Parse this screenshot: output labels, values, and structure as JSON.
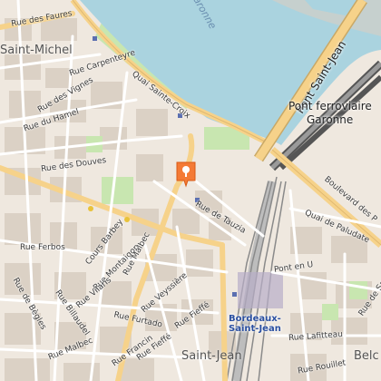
{
  "map": {
    "colors": {
      "water": "#aad3df",
      "land": "#efe8df",
      "park": "#c8e6b0",
      "road_major": "#f6d28a",
      "road_minor": "#ffffff",
      "building": "#d9cfc3",
      "rail": "#8a8a8a",
      "marker": "#f47a35"
    },
    "marker": {
      "icon": "map-pin-icon"
    },
    "labels": {
      "garonne_top": "Garonne",
      "saint_michel": "Saint-Michel",
      "rue_des_faures": "Rue des Faures",
      "rue_carpenteyre": "Rue Carpenteyre",
      "quai_sainte_croix": "Quai Sainte-Croix",
      "rue_des_vignes": "Rue des Vignes",
      "rue_du_hamel": "Rue du Hamel",
      "rue_des_douves": "Rue des Douves",
      "rue_de_tauzia": "Rue de Tauzia",
      "pont_saint_jean": "Pont Saint-Jean",
      "pont_ferroviaire": "Pont ferroviaire",
      "garonne": "Garonne",
      "boulevard_des": "Boulevard des P",
      "quai_de_paludate": "Quai de Paludate",
      "rue_ferbos": "Rue Ferbos",
      "cours_barbey": "Cours Barbey",
      "rue_montaigon": "Rue Montaigon",
      "rue_malbec_1": "Rue Malbec",
      "rue_vilaris": "Rue Vilaris",
      "rue_de_begles": "Rue de Bègles",
      "rue_billaudel": "Rue Billaudel",
      "rue_veyssiere": "Rue Veyssière",
      "rue_furtado": "Rue Furtado",
      "rue_fieffe_1": "Rue Fieffé",
      "rue_malbec_2": "Rue Malbec",
      "rue_francin": "Rue Francin",
      "rue_fieffe_2": "Rue Fieffé",
      "saint_jean": "Saint-Jean",
      "bordeaux_saint_jean": "Bordeaux-\nSaint-Jean",
      "pont_en_u": "Pont en U",
      "rue_de_saget": "Rue de Saget",
      "rue_lafitteau": "Rue Lafitteau",
      "rue_rouillet": "Rue Rouillet",
      "belcier": "Belc"
    }
  }
}
